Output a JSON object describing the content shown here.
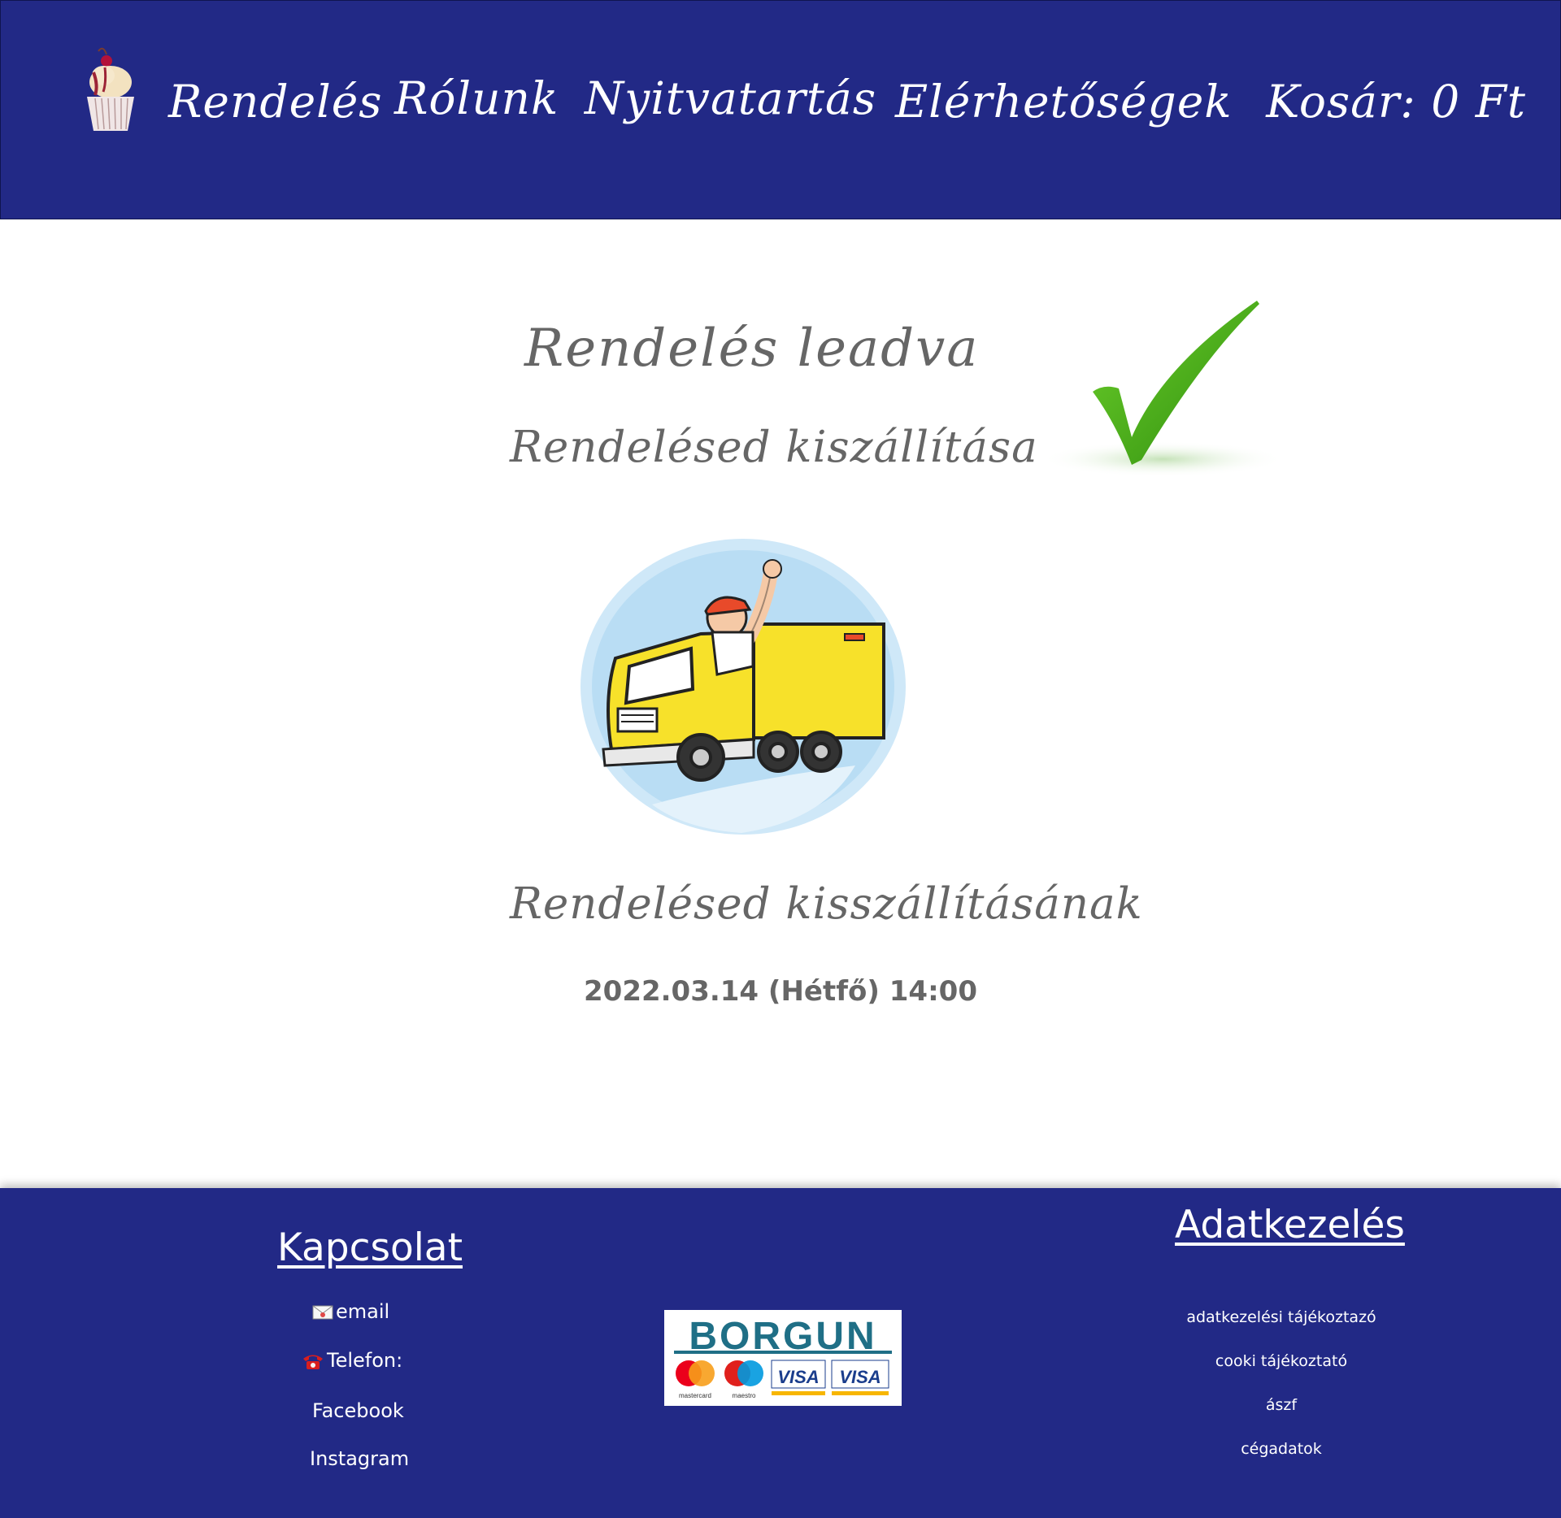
{
  "header": {
    "nav": {
      "order": "Rendelés",
      "about": "Rólunk",
      "hours": "Nyitvatartás",
      "contacts": "Elérhetőségek"
    },
    "cart": "Kosár: 0 Ft"
  },
  "main": {
    "title": "Rendelés leadva",
    "subtitle": "Rendelésed kiszállítása",
    "delivery_label": "Rendelésed kisszállításának",
    "delivery_datetime": "2022.03.14 (Hétfő) 14:00"
  },
  "footer": {
    "contact": {
      "heading": "Kapcsolat",
      "email": "email",
      "phone": "Telefon:",
      "facebook": "Facebook",
      "instagram": "Instagram"
    },
    "payment_logo": {
      "brand": "BORGUN",
      "cards": [
        "mastercard",
        "maestro",
        "VISA",
        "VISA"
      ]
    },
    "privacy": {
      "heading": "Adatkezelés",
      "links": [
        "adatkezelési tájékoztazó",
        "cooki tájékoztató",
        "ászf",
        "cégadatok"
      ]
    }
  },
  "colors": {
    "brand_blue": "#222986",
    "text_gray": "#666666",
    "check_green": "#3fa115",
    "truck_yellow": "#f7e12a"
  },
  "icons": [
    "cupcake-logo",
    "checkmark-icon",
    "delivery-truck-illustration",
    "envelope-icon",
    "telephone-icon"
  ]
}
